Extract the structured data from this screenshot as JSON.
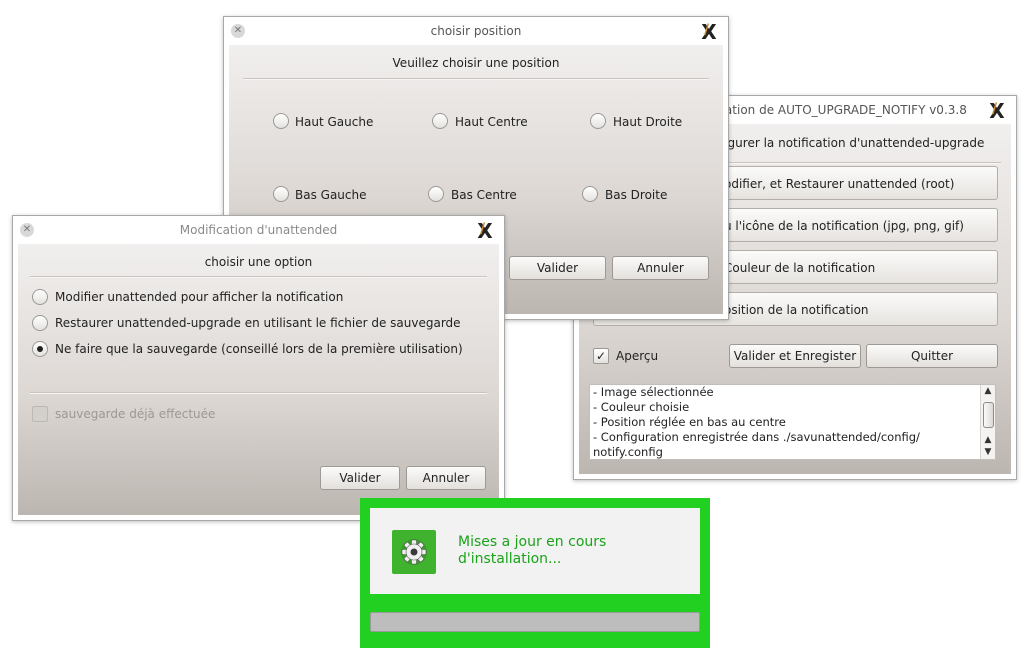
{
  "config_window": {
    "title": "ration de AUTO_UPGRADE_NOTIFY  v0.3.8",
    "heading": "figurer la notification d'unattended-upgrade",
    "buttons": [
      "odifier, et Restaurer unattended (root)",
      "u l'icône de la notification (jpg, png, gif)",
      "Couleur de la notification",
      "osition de la notification"
    ],
    "preview_label": "Aperçu",
    "preview_checked": true,
    "save_button": "Valider et Enregister",
    "quit_button": "Quitter",
    "log_lines": [
      "- Image sélectionnée",
      "- Couleur choisie",
      "- Position réglée en bas au centre",
      "- Configuration enregistrée dans ./savunattended/config/",
      "notify.config"
    ],
    "icons": {
      "close": "close-icon",
      "app": "x-app-icon",
      "scroll_up": "chevron-up-icon",
      "scroll_down": "chevron-down-icon"
    }
  },
  "position_window": {
    "title": "choisir position",
    "heading": "Veuillez choisir une position",
    "options": [
      "Haut Gauche",
      "Haut Centre",
      "Haut Droite",
      "Bas Gauche",
      "Bas Centre",
      "Bas Droite"
    ],
    "ok_button": "Valider",
    "cancel_button": "Annuler"
  },
  "option_window": {
    "title": "Modification d'unattended",
    "heading": "choisir une option",
    "options": [
      "Modifier unattended pour afficher la notification",
      "Restaurer unattended-upgrade en utilisant le fichier de sauvegarde",
      "Ne faire que la sauvegarde (conseillé lors de la première utilisation)"
    ],
    "selected_option": 2,
    "backup_done_label": "sauvegarde déjà effectuée",
    "ok_button": "Valider",
    "cancel_button": "Annuler"
  },
  "notification": {
    "line1": "Mises a jour en cours",
    "line2": "d'installation...",
    "progress_fraction": 0.0,
    "icon": "gear-icon",
    "colors": {
      "frame": "#22d022",
      "text": "#1aa31a",
      "icon_bg": "#3fb32e"
    }
  }
}
